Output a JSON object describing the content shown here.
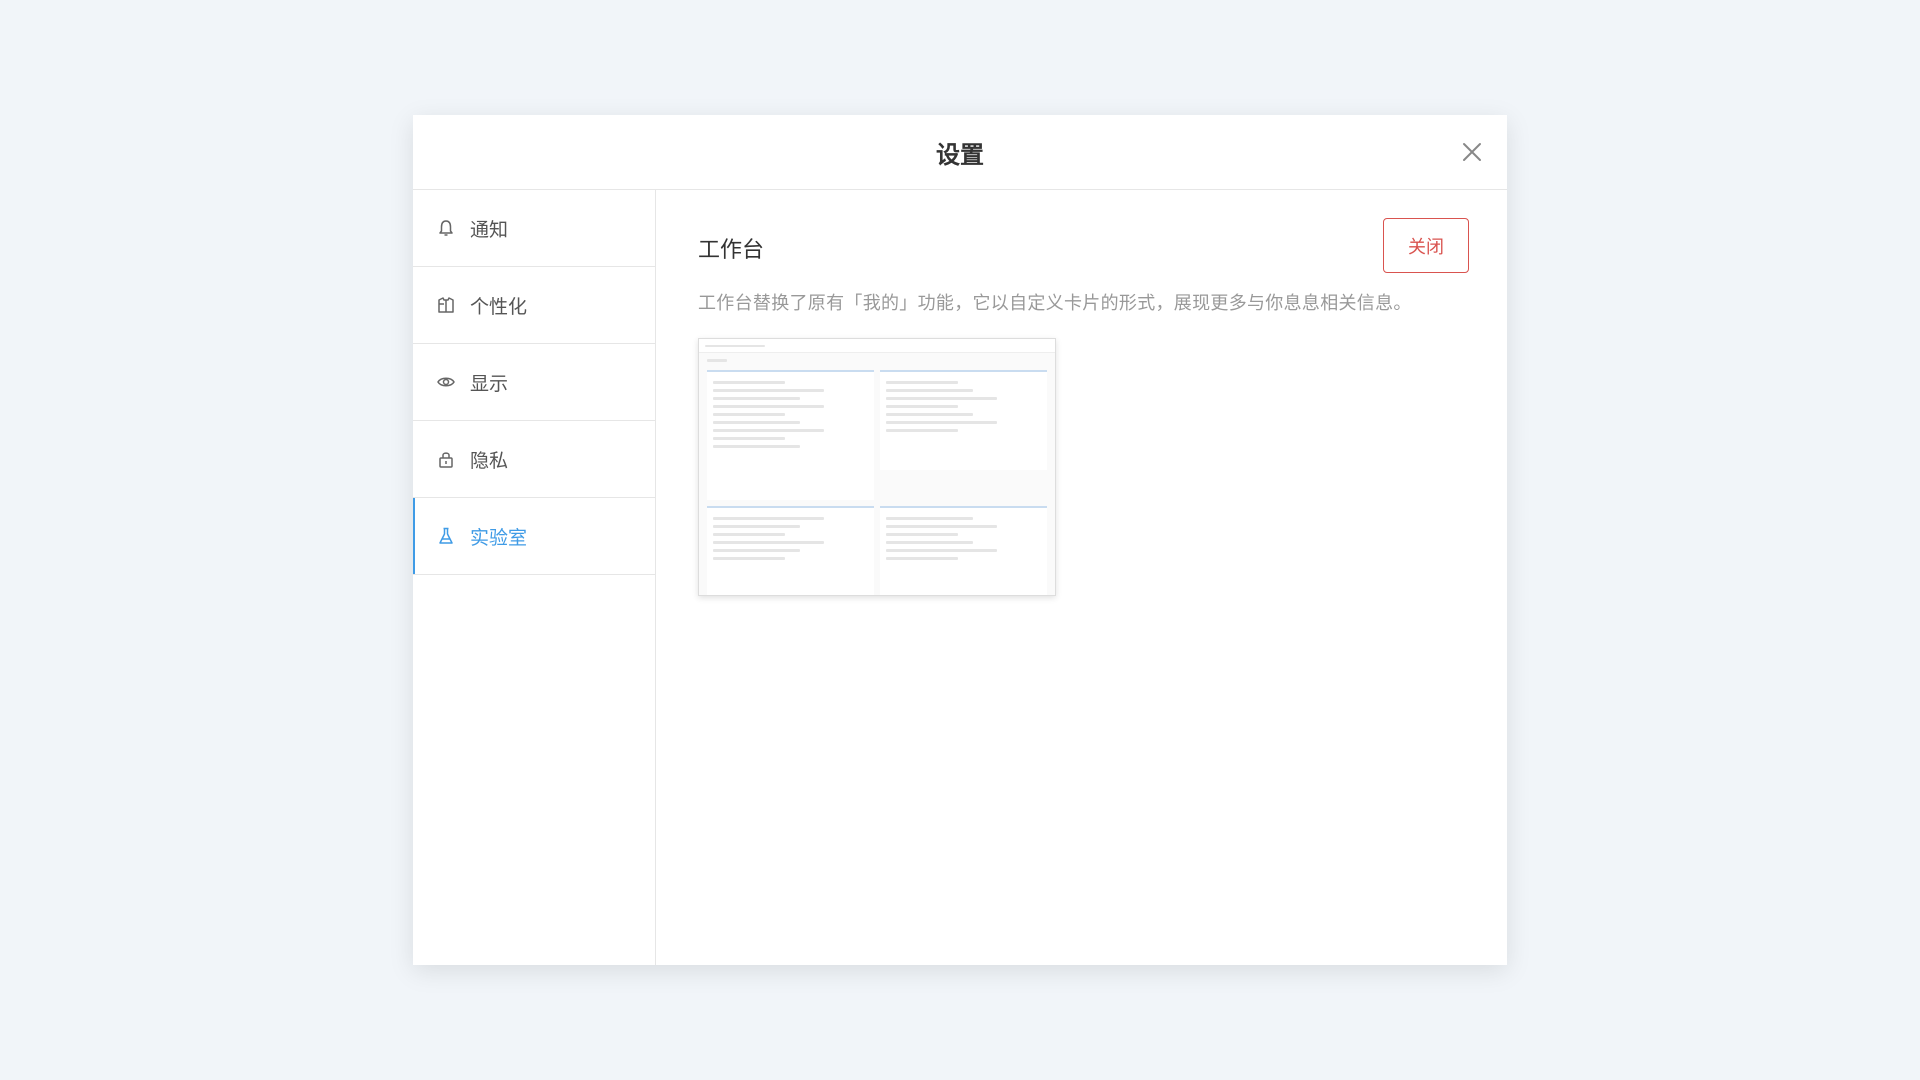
{
  "modal": {
    "title": "设置"
  },
  "sidebar": {
    "items": [
      {
        "label": "通知",
        "icon": "bell-icon"
      },
      {
        "label": "个性化",
        "icon": "shirt-icon"
      },
      {
        "label": "显示",
        "icon": "eye-icon"
      },
      {
        "label": "隐私",
        "icon": "lock-icon"
      },
      {
        "label": "实验室",
        "icon": "flask-icon",
        "active": true
      }
    ]
  },
  "content": {
    "section_title": "工作台",
    "toggle_label": "关闭",
    "description": "工作台替换了原有「我的」功能，它以自定义卡片的形式，展现更多与你息息相关信息。"
  },
  "colors": {
    "accent": "#3f9be6",
    "danger": "#d9534f",
    "background": "#f1f5f9"
  }
}
